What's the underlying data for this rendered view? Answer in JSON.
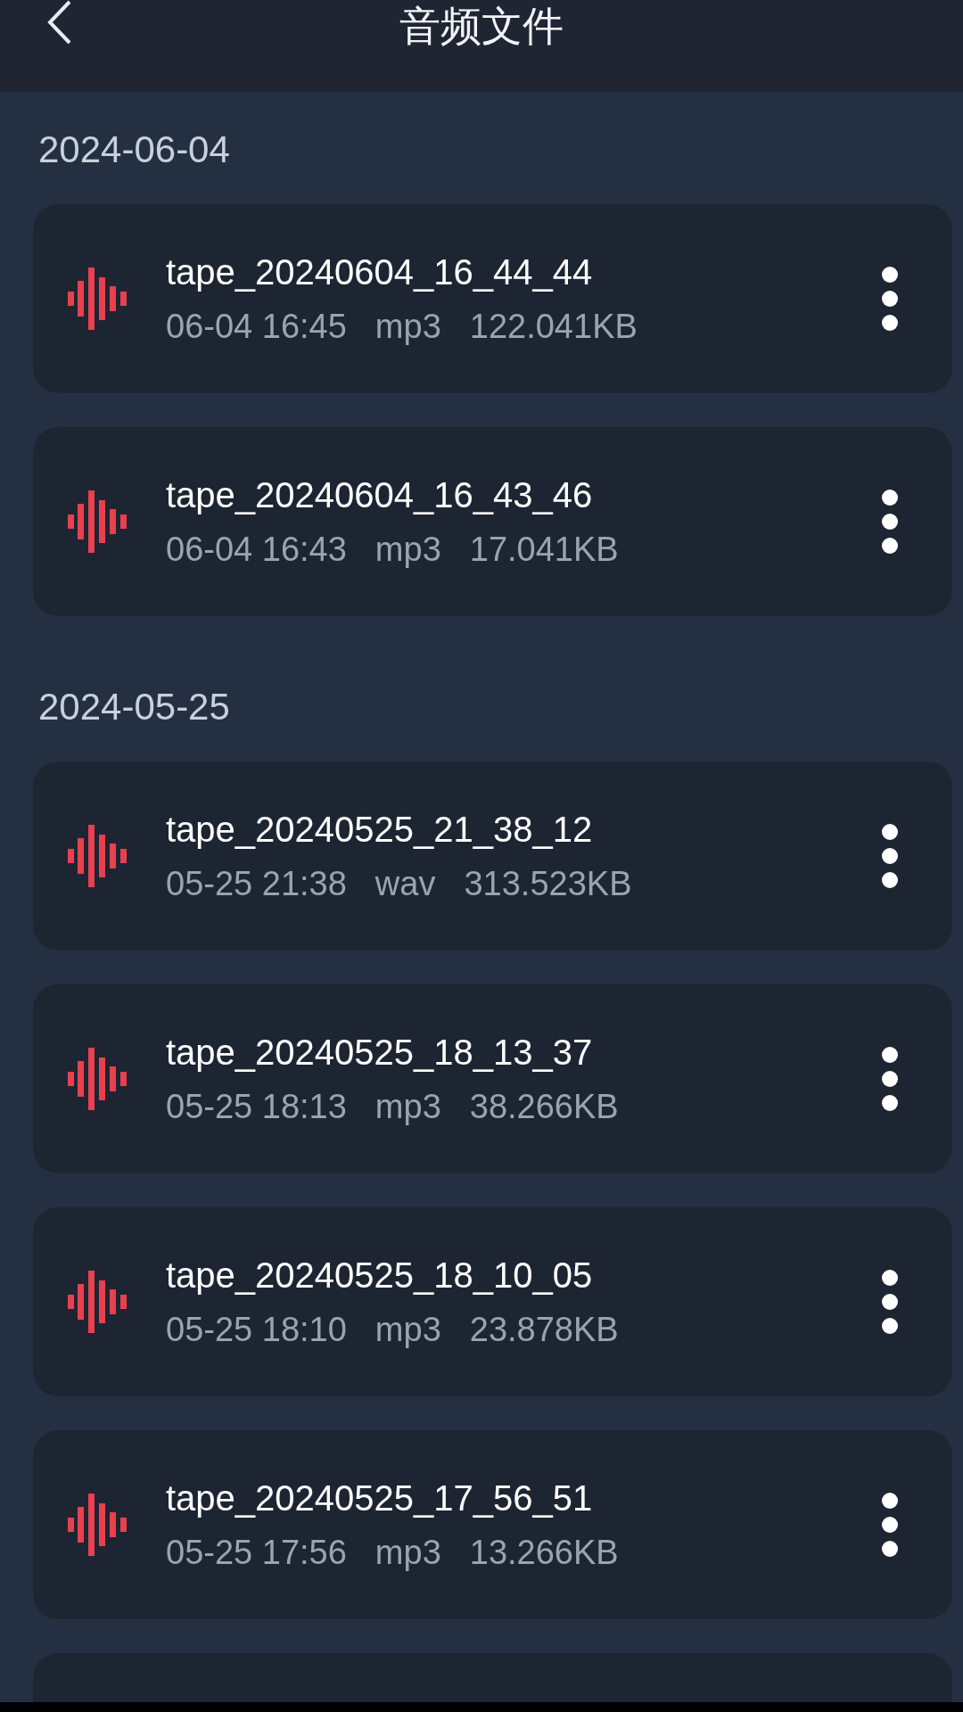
{
  "header": {
    "title": "音频文件"
  },
  "sections": [
    {
      "date": "2024-06-04",
      "files": [
        {
          "name": "tape_20240604_16_44_44",
          "time": "06-04 16:45",
          "format": "mp3",
          "size": "122.041KB"
        },
        {
          "name": "tape_20240604_16_43_46",
          "time": "06-04 16:43",
          "format": "mp3",
          "size": "17.041KB"
        }
      ]
    },
    {
      "date": "2024-05-25",
      "files": [
        {
          "name": "tape_20240525_21_38_12",
          "time": "05-25 21:38",
          "format": "wav",
          "size": "313.523KB"
        },
        {
          "name": "tape_20240525_18_13_37",
          "time": "05-25 18:13",
          "format": "mp3",
          "size": "38.266KB"
        },
        {
          "name": "tape_20240525_18_10_05",
          "time": "05-25 18:10",
          "format": "mp3",
          "size": "23.878KB"
        },
        {
          "name": "tape_20240525_17_56_51",
          "time": "05-25 17:56",
          "format": "mp3",
          "size": "13.266KB"
        }
      ]
    }
  ]
}
